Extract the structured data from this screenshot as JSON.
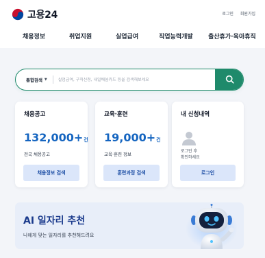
{
  "header": {
    "logo_text": "고용24",
    "util_links": [
      "로그인",
      "회원가입"
    ]
  },
  "nav": {
    "items": [
      "채용정보",
      "취업지원",
      "실업급여",
      "직업능력개발",
      "출산휴가·육아휴직"
    ]
  },
  "search": {
    "category": "통합검색",
    "placeholder": "실업급여, 구직신청, 내일배움카드 등을 검색해보세요",
    "icon": "search-icon"
  },
  "cards": {
    "jobs": {
      "title": "채용공고",
      "number": "132,000+",
      "unit": "건",
      "sub": "전국 채용공고",
      "button": "채용정보 검색"
    },
    "training": {
      "title": "교육·훈련",
      "number": "19,000+",
      "unit": "건",
      "sub": "교육·훈련 정보",
      "button": "훈련과정 검색"
    },
    "myapps": {
      "title": "내 신청내역",
      "note_line1": "로그인 후",
      "note_line2": "확인하세요",
      "button": "로그인"
    }
  },
  "ai_banner": {
    "title": "AI 일자리 추천",
    "subtitle": "나에게 맞는 일자리를 추천해드려요"
  },
  "colors": {
    "primary_green": "#1f8a6b",
    "number_blue": "#1565c0",
    "button_bg": "#dbe6fa",
    "banner_bg": "#e8eef9"
  }
}
